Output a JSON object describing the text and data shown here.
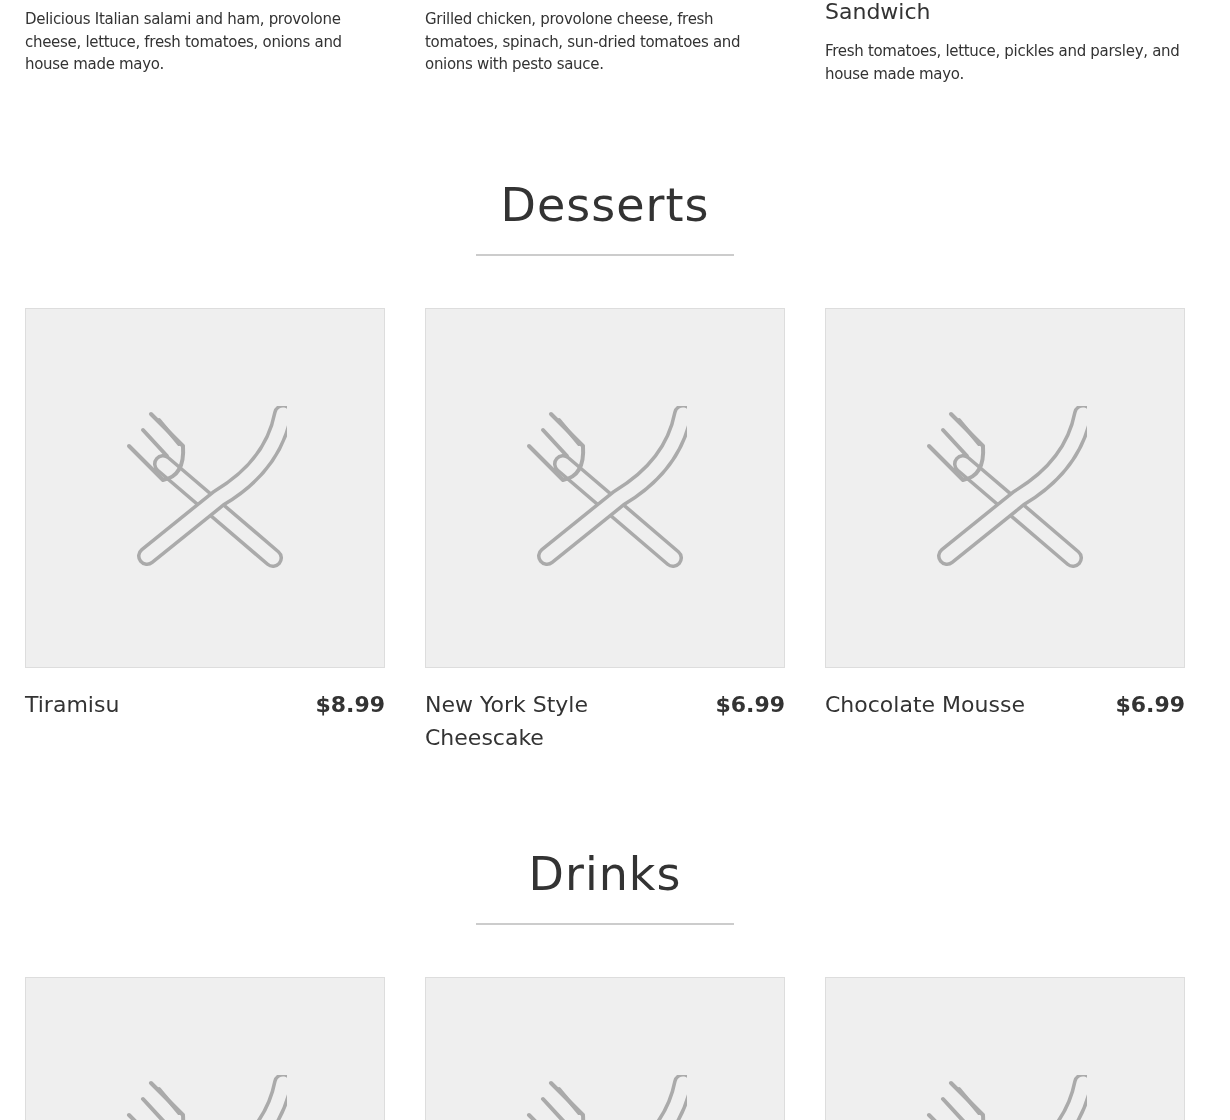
{
  "top_items": [
    {
      "description": "Delicious Italian salami and ham, provolone cheese, lettuce, fresh tomatoes, onions and house made mayo."
    },
    {
      "description": "Grilled chicken, provolone cheese, fresh tomatoes, spinach, sun-dried tomatoes and onions with pesto sauce."
    },
    {
      "title": "Sandwich",
      "description": "Fresh tomatoes, lettuce, pickles and parsley, and house made mayo."
    }
  ],
  "sections": [
    {
      "heading": "Desserts",
      "items": [
        {
          "kind": "placeholder",
          "name": "Tiramisu",
          "price": "$8.99"
        },
        {
          "kind": "placeholder",
          "name": "New York Style Cheescake",
          "price": "$6.99"
        },
        {
          "kind": "placeholder",
          "name": "Chocolate Mousse",
          "price": "$6.99"
        }
      ]
    },
    {
      "heading": "Drinks",
      "items": [
        {
          "kind": "placeholder"
        },
        {
          "kind": "placeholder"
        },
        {
          "kind": "placeholder"
        }
      ]
    }
  ]
}
